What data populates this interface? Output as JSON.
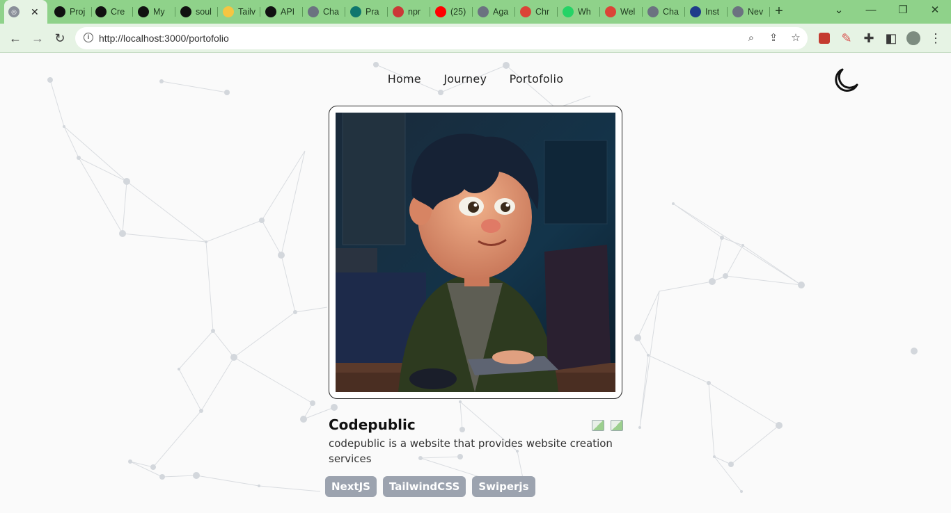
{
  "browser": {
    "tabs": [
      {
        "label": "",
        "fav": "globe-icon",
        "color": "#6b7280",
        "active": true
      },
      {
        "label": "Proj",
        "fav": "vercel-icon",
        "color": "#111111"
      },
      {
        "label": "Cre",
        "fav": "vercel-icon",
        "color": "#111111"
      },
      {
        "label": "My",
        "fav": "triangle-icon",
        "color": "#111111"
      },
      {
        "label": "soul",
        "fav": "github-icon",
        "color": "#111111"
      },
      {
        "label": "Tailv",
        "fav": "bulb-icon",
        "color": "#f5c542"
      },
      {
        "label": "API",
        "fav": "nextjs-icon",
        "color": "#111111"
      },
      {
        "label": "Cha",
        "fav": "openai-icon",
        "color": "#6b7280"
      },
      {
        "label": "Pra",
        "fav": "face-icon",
        "color": "#0f766e"
      },
      {
        "label": "npr",
        "fav": "npm-icon",
        "color": "#cb3837"
      },
      {
        "label": "(25)",
        "fav": "youtube-icon",
        "color": "#ff0000"
      },
      {
        "label": "Aga",
        "fav": "globe-icon",
        "color": "#6b7280"
      },
      {
        "label": "Chr",
        "fav": "chrome-store-icon",
        "color": "#db4437"
      },
      {
        "label": "Wh",
        "fav": "whatsapp-icon",
        "color": "#25d366"
      },
      {
        "label": "Wel",
        "fav": "chrome-store-icon",
        "color": "#db4437"
      },
      {
        "label": "Cha",
        "fav": "openai-icon",
        "color": "#6b7280"
      },
      {
        "label": "Inst",
        "fav": "gh-icon",
        "color": "#1f3b8a"
      },
      {
        "label": "Nev",
        "fav": "globe-icon",
        "color": "#6b7280"
      }
    ],
    "url": "http://localhost:3000/portofolio"
  },
  "nav": {
    "links": [
      "Home",
      "Journey",
      "Portofolio"
    ]
  },
  "project": {
    "title": "Codepublic",
    "description": "codepublic is a website that provides website creation services",
    "tags": [
      "NextJS",
      "TailwindCSS",
      "Swiperjs"
    ]
  },
  "colors": {
    "tab_bar": "#8fd28a",
    "toolbar": "#e6f3e4",
    "tag_bg": "#9ca3af",
    "page_bg": "#fafafa"
  }
}
